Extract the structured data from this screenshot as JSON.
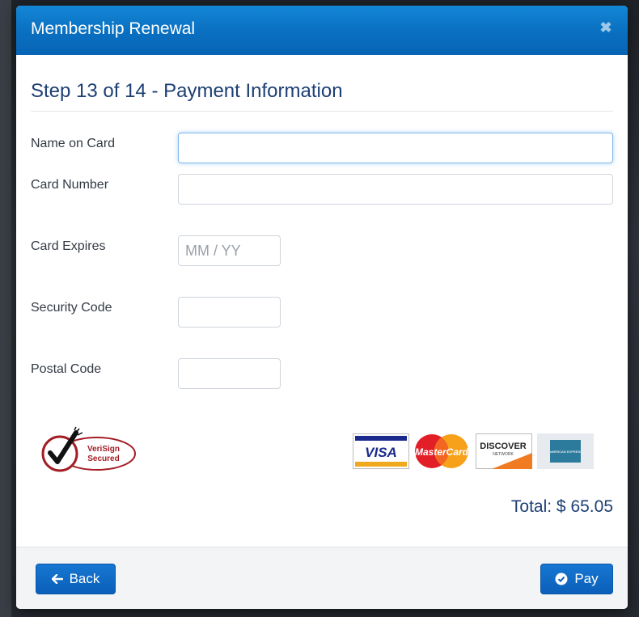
{
  "modal": {
    "title": "Membership Renewal",
    "close_icon": "close-icon"
  },
  "step": {
    "title": "Step 13 of 14 - Payment Information"
  },
  "form": {
    "name_on_card": {
      "label": "Name on Card",
      "value": ""
    },
    "card_number": {
      "label": "Card Number",
      "value": ""
    },
    "card_expires": {
      "label": "Card Expires",
      "value": "",
      "placeholder": "MM / YY"
    },
    "security_code": {
      "label": "Security Code",
      "value": ""
    },
    "postal_code": {
      "label": "Postal Code",
      "value": ""
    }
  },
  "security_badge": {
    "line1": "VeriSign",
    "line2": "Secured"
  },
  "card_logos": [
    {
      "name": "VISA",
      "icon": "visa-logo"
    },
    {
      "name": "MasterCard",
      "icon": "mastercard-logo"
    },
    {
      "name": "DISCOVER",
      "sub": "NETWORK",
      "icon": "discover-logo"
    },
    {
      "name": "AMERICAN EXPRESS",
      "icon": "amex-logo"
    }
  ],
  "total": {
    "label": "Total: $ 65.05"
  },
  "footer": {
    "back_label": "Back",
    "back_icon": "arrow-left-icon",
    "pay_label": "Pay",
    "pay_icon": "check-circle-icon"
  },
  "colors": {
    "header": "#0a6fc0",
    "title_text": "#1d3f73",
    "button": "#0b5fb8"
  }
}
